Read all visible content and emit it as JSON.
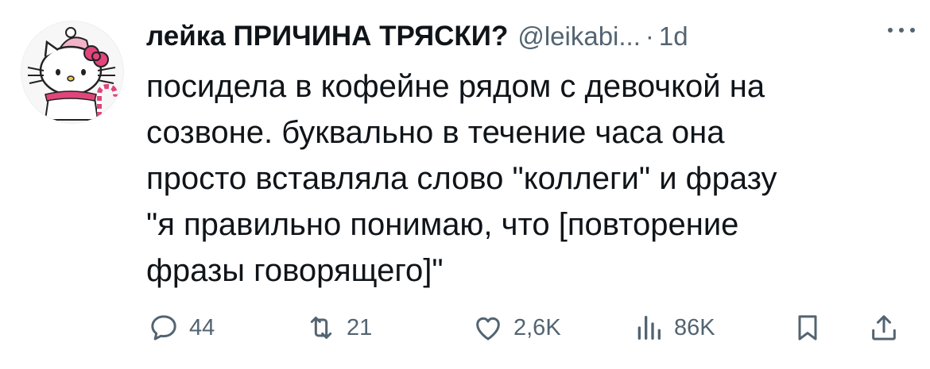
{
  "tweet": {
    "display_name": "лейка ПРИЧИНА ТРЯСКИ?",
    "handle": "@leikabi...",
    "separator": "·",
    "time": "1d",
    "more_icon": "more-dots-icon",
    "text_lines": [
      "посидела в кофейне рядом с девочкой на",
      "созвоне. буквально в течение часа она",
      "просто вставляла слово \"коллеги\" и фразу",
      "\"я правильно понимаю, что [повторение",
      "фразы говорящего]\""
    ]
  },
  "actions": {
    "reply": {
      "icon": "reply-bubble-icon",
      "count": "44"
    },
    "retweet": {
      "icon": "retweet-icon",
      "count": "21"
    },
    "like": {
      "icon": "heart-icon",
      "count": "2,6K"
    },
    "views": {
      "icon": "views-bar-icon",
      "count": "86K"
    },
    "bookmark": {
      "icon": "bookmark-icon"
    },
    "share": {
      "icon": "share-icon"
    }
  },
  "colors": {
    "text": "#0f1419",
    "secondary": "#536471",
    "avatar_accent": "#e0457b"
  }
}
